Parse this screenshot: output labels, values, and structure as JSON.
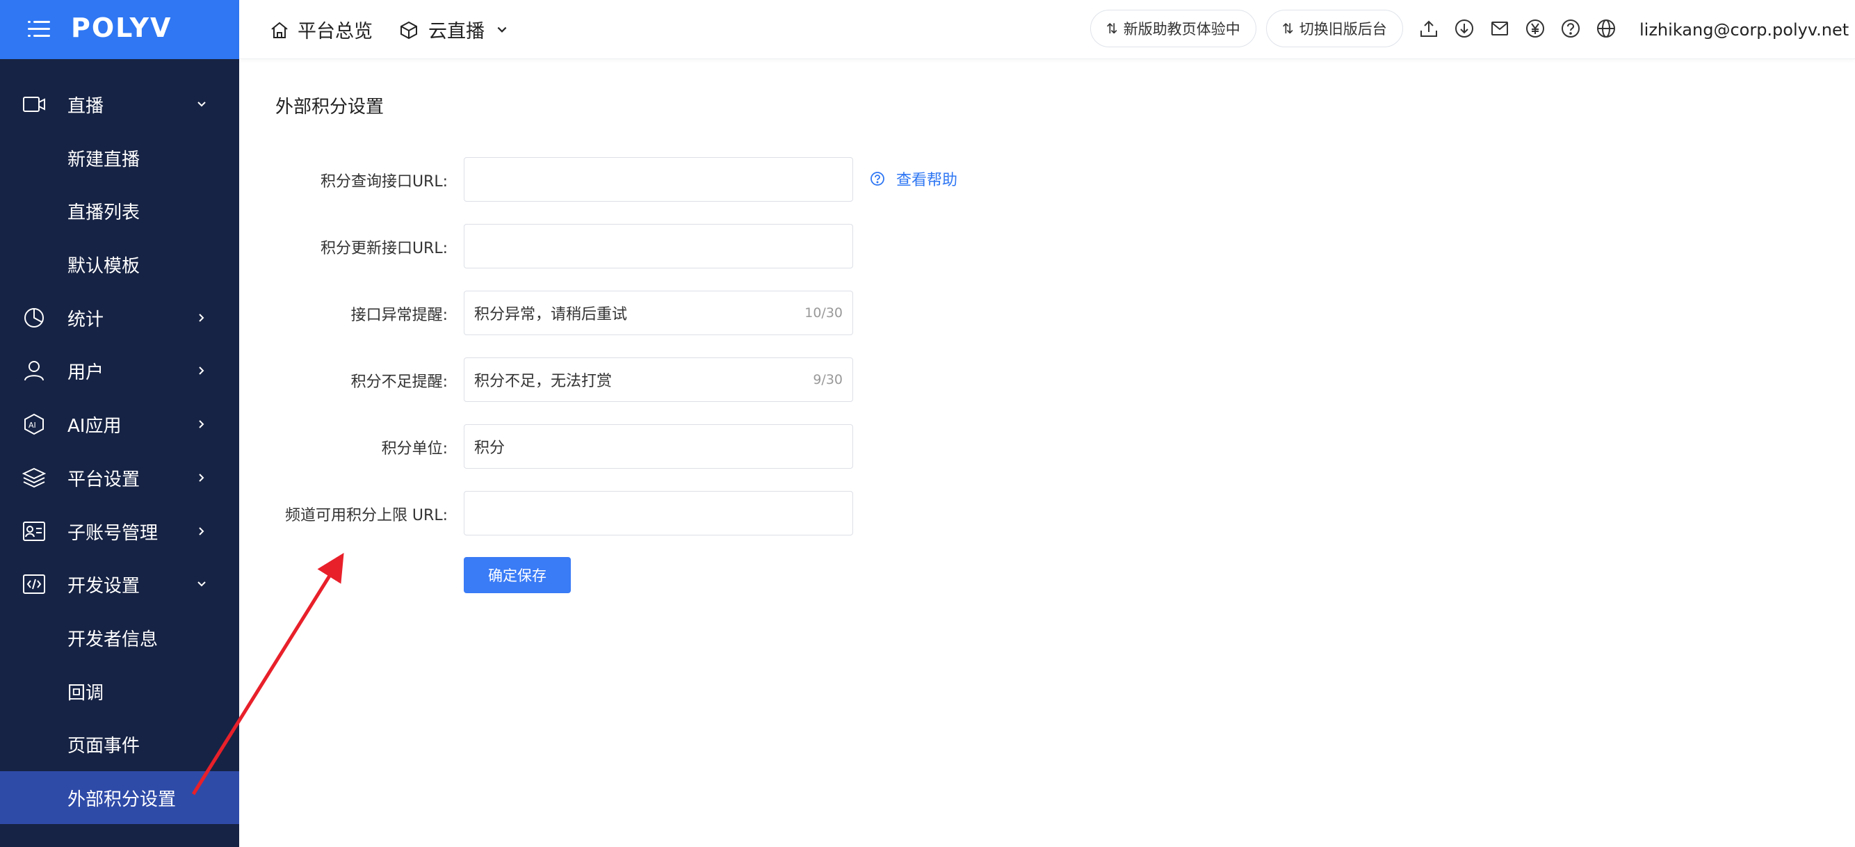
{
  "brand": {
    "logo": "POLYV",
    "accent": "#2f77f3",
    "sidebar_bg": "#172344",
    "active_bg": "#2f4ba8"
  },
  "header": {
    "nav": [
      {
        "label": "平台总览",
        "icon": "home-icon"
      },
      {
        "label": "云直播",
        "icon": "cube-icon"
      }
    ],
    "pills": [
      "新版助教页体验中",
      "切换旧版后台"
    ],
    "icons": [
      "upload-icon",
      "download-icon",
      "mail-icon",
      "yen-icon",
      "help-icon",
      "globe-icon"
    ],
    "user_email": "lizhikang@corp.polyv.net"
  },
  "sidebar": {
    "items": [
      {
        "label": "直播",
        "icon": "video-camera-icon",
        "expanded": true
      },
      {
        "label": "新建直播"
      },
      {
        "label": "直播列表"
      },
      {
        "label": "默认模板"
      },
      {
        "label": "统计",
        "icon": "pie-chart-icon"
      },
      {
        "label": "用户",
        "icon": "user-icon"
      },
      {
        "label": "AI应用",
        "icon": "ai-icon"
      },
      {
        "label": "平台设置",
        "icon": "layers-icon"
      },
      {
        "label": "子账号管理",
        "icon": "id-card-icon"
      },
      {
        "label": "开发设置",
        "icon": "code-icon",
        "expanded": true
      },
      {
        "label": "开发者信息"
      },
      {
        "label": "回调"
      },
      {
        "label": "页面事件"
      },
      {
        "label": "外部积分设置",
        "active": true
      }
    ]
  },
  "page": {
    "title": "外部积分设置",
    "help_link": "查看帮助",
    "fields": [
      {
        "label": "积分查询接口URL:",
        "value": "",
        "count": ""
      },
      {
        "label": "积分更新接口URL:",
        "value": "",
        "count": ""
      },
      {
        "label": "接口异常提醒:",
        "value": "积分异常，请稍后重试",
        "count": "10/30"
      },
      {
        "label": "积分不足提醒:",
        "value": "积分不足，无法打赏",
        "count": "9/30"
      },
      {
        "label": "积分单位:",
        "value": "积分",
        "count": ""
      },
      {
        "label": "频道可用积分上限 URL:",
        "value": "",
        "count": ""
      }
    ],
    "save_label": "确定保存"
  },
  "annotation": {
    "color": "#e8202a"
  }
}
